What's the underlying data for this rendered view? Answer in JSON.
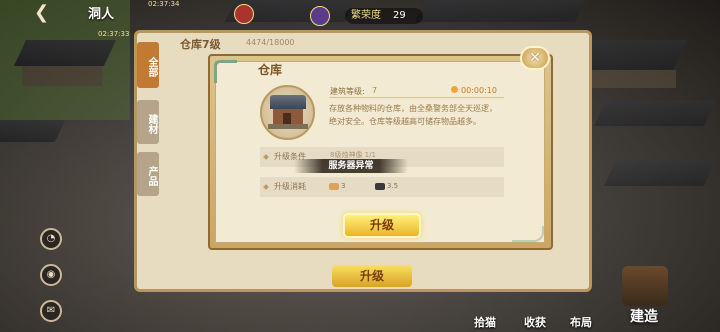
{
  "hud": {
    "back_glyph": "❮",
    "player_name": "洞人",
    "timer_left": "02:37:33",
    "timer_top": "02:37:34",
    "resource_label": "繁荣度",
    "resource_value": "29"
  },
  "background_panel": {
    "title": "仓库7级",
    "subtitle": "4474/18000",
    "tabs": [
      {
        "label": "全部"
      },
      {
        "label": "建材"
      },
      {
        "label": "产品"
      }
    ],
    "upgrade_label": "升级"
  },
  "dialog": {
    "title": "仓库",
    "close_glyph": "✕",
    "level_label": "建筑等级:",
    "level_value": "7",
    "timer_value": "00:00:10",
    "description": "存放各种物料的仓库，由全桑警务部全天巡逻，绝对安全。仓库等级越高可储存物品越多。",
    "condition_label": "升级条件",
    "condition_value": "8级烛神像 1/1",
    "warning_text": "服务器异常",
    "cost_label": "升级消耗",
    "costs": [
      {
        "icon": "wood-icon",
        "value": "3"
      },
      {
        "icon": "stone-icon",
        "value": "3.5"
      }
    ],
    "upgrade_label": "升级"
  },
  "bottom_bar": {
    "labels": [
      "拾猫",
      "收获",
      "布局"
    ],
    "store_label": "建造"
  },
  "colors": {
    "accent_gold": "#e9b52a",
    "panel_bg": "#f3ead3",
    "title_brown": "#7a5526"
  }
}
